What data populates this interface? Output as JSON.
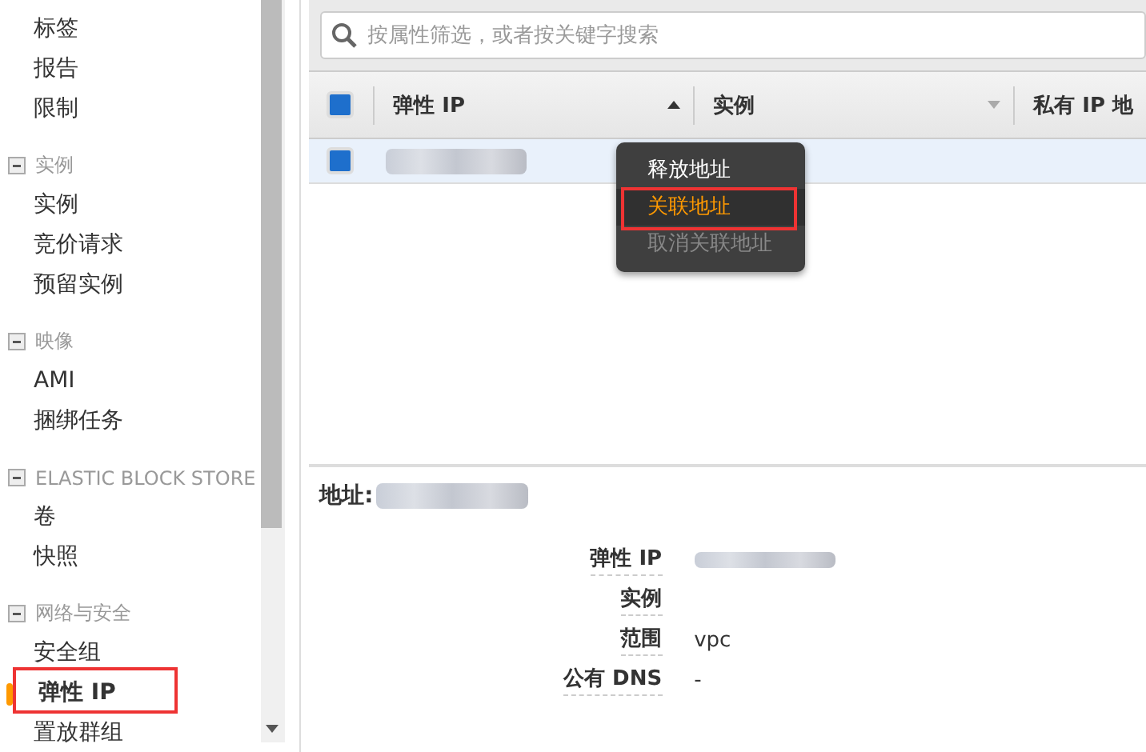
{
  "sidebar": {
    "groups": [
      {
        "items": [
          {
            "label": "标签",
            "selected": false
          },
          {
            "label": "报告",
            "selected": false
          },
          {
            "label": "限制",
            "selected": false
          }
        ]
      },
      {
        "title": "实例",
        "expanded": true,
        "items": [
          {
            "label": "实例",
            "selected": false
          },
          {
            "label": "竞价请求",
            "selected": false
          },
          {
            "label": "预留实例",
            "selected": false
          }
        ]
      },
      {
        "title": "映像",
        "expanded": true,
        "items": [
          {
            "label": "AMI",
            "selected": false
          },
          {
            "label": "捆绑任务",
            "selected": false
          }
        ]
      },
      {
        "title": "ELASTIC BLOCK STORE",
        "expanded": true,
        "items": [
          {
            "label": "卷",
            "selected": false
          },
          {
            "label": "快照",
            "selected": false
          }
        ]
      },
      {
        "title": "网络与安全",
        "expanded": true,
        "items": [
          {
            "label": "安全组",
            "selected": false
          },
          {
            "label": "弹性 IP",
            "selected": true
          },
          {
            "label": "置放群组",
            "selected": false
          }
        ]
      }
    ]
  },
  "search": {
    "placeholder": "按属性筛选，或者按关键字搜索"
  },
  "table": {
    "header_checked": true,
    "columns": [
      {
        "label": "弹性 IP",
        "sorted": true,
        "filter_menu": false
      },
      {
        "label": "实例",
        "sorted": false,
        "filter_menu": true
      },
      {
        "label": "私有 IP 地",
        "sorted": false,
        "filter_menu": false
      }
    ],
    "rows": [
      {
        "selected": true,
        "checked": true
      }
    ]
  },
  "context_menu": [
    {
      "label": "释放地址",
      "kind": "normal"
    },
    {
      "label": "关联地址",
      "kind": "hover"
    },
    {
      "label": "取消关联地址",
      "kind": "disabled"
    }
  ],
  "details": {
    "title": "地址:",
    "fields": [
      {
        "label": "弹性 IP",
        "redacted": true
      },
      {
        "label": "实例",
        "redacted": false
      },
      {
        "label": "范围",
        "value": "vpc"
      },
      {
        "label": "公有 DNS",
        "value": "-"
      }
    ]
  }
}
